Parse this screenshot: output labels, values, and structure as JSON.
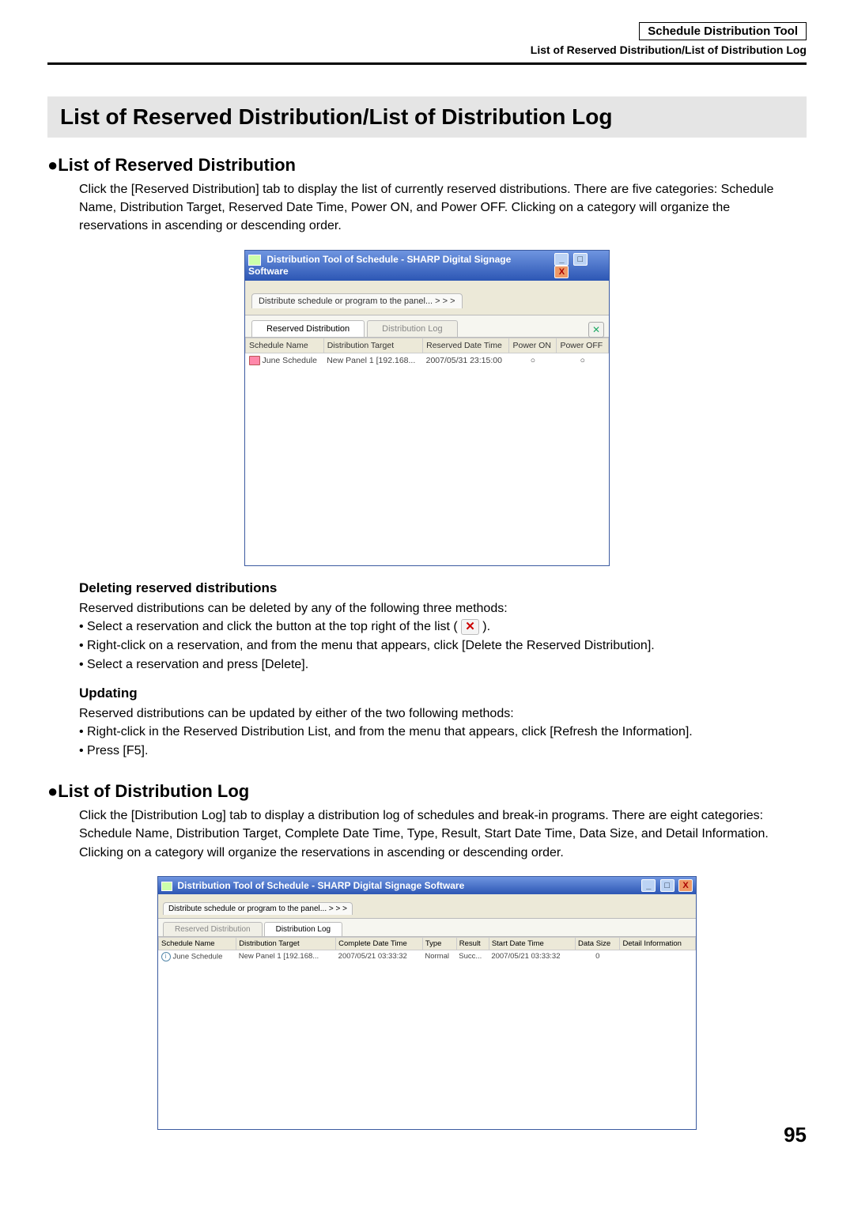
{
  "header": {
    "tool_name": "Schedule Distribution Tool",
    "subtitle": "List of Reserved Distribution/List of Distribution Log"
  },
  "title": "List of Reserved Distribution/List of Distribution Log",
  "section1": {
    "heading": "●List of Reserved Distribution",
    "para": "Click the [Reserved Distribution] tab to display the list of currently reserved distributions. There are five categories: Schedule Name, Distribution Target, Reserved Date Time, Power ON, and Power OFF. Clicking on a category will organize the reservations in ascending or descending order."
  },
  "shot1": {
    "window_title": "Distribution Tool of Schedule - SHARP Digital Signage Software",
    "top_tab": "Distribute schedule or program to the panel...   > > >",
    "tab_reserved": "Reserved Distribution",
    "tab_log": "Distribution Log",
    "columns": [
      "Schedule Name",
      "Distribution Target",
      "Reserved Date Time",
      "Power ON",
      "Power OFF"
    ],
    "row": {
      "name": "June Schedule",
      "target": "New Panel 1 [192.168...",
      "date": "2007/05/31 23:15:00",
      "on": "○",
      "off": "○"
    }
  },
  "deleting": {
    "heading": "Deleting reserved distributions",
    "intro": "Reserved distributions can be deleted by any of the following three methods:",
    "b1a": "Select a reservation and click the button at the top right of the list (",
    "b1b": ").",
    "b2": "Right-click on a reservation, and from the menu that appears, click [Delete the Reserved Distribution].",
    "b3": "Select a reservation and press [Delete]."
  },
  "updating": {
    "heading": "Updating",
    "intro": "Reserved distributions can be updated by either of the two following methods:",
    "b1": "Right-click in the Reserved Distribution List, and from the menu that appears, click [Refresh the Information].",
    "b2": "Press [F5]."
  },
  "section2": {
    "heading": "●List of Distribution Log",
    "para": "Click the [Distribution Log] tab to display a distribution log of schedules and break-in programs. There are eight categories: Schedule Name, Distribution Target, Complete Date Time, Type, Result, Start Date Time, Data Size, and Detail Information. Clicking on a category will organize the reservations in ascending or descending order."
  },
  "shot2": {
    "window_title": "Distribution Tool of Schedule - SHARP Digital Signage Software",
    "top_tab": "Distribute schedule or program to the panel...   > > >",
    "tab_reserved": "Reserved Distribution",
    "tab_log": "Distribution Log",
    "columns": [
      "Schedule Name",
      "Distribution Target",
      "Complete Date Time",
      "Type",
      "Result",
      "Start Date Time",
      "Data Size",
      "Detail Information"
    ],
    "row": {
      "name": "June Schedule",
      "target": "New Panel 1 [192.168...",
      "complete": "2007/05/21 03:33:32",
      "type": "Normal",
      "result": "Succ...",
      "start": "2007/05/21 03:33:32",
      "size": "0",
      "detail": ""
    }
  },
  "page_number": "95"
}
